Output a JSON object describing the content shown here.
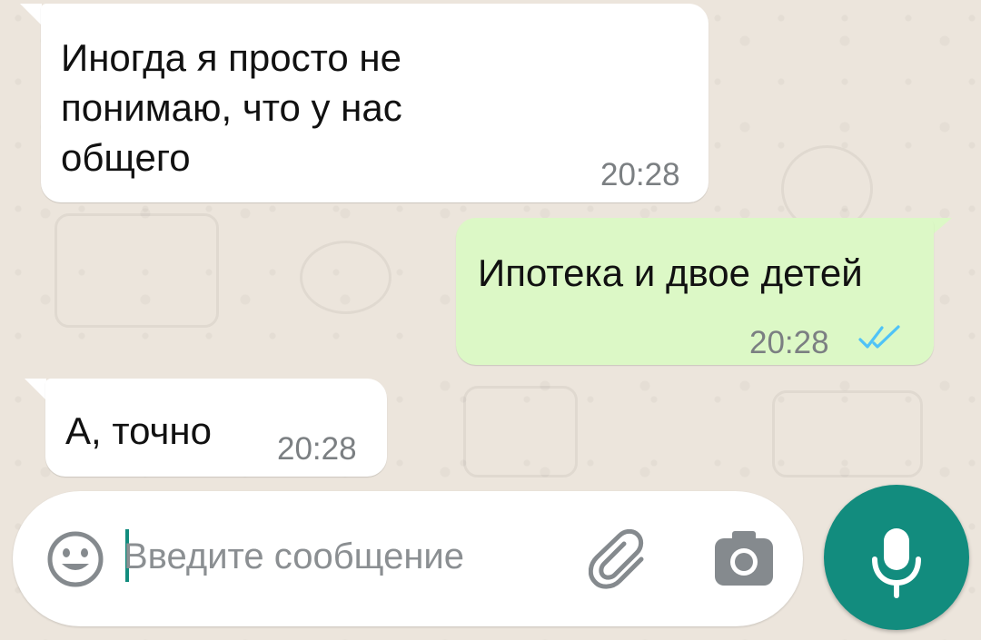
{
  "messages": [
    {
      "direction": "incoming",
      "text": "Иногда я просто не\nпонимаю, что у нас\nобщего",
      "time": "20:28"
    },
    {
      "direction": "outgoing",
      "text": "Ипотека и двое детей",
      "time": "20:28",
      "status": "read"
    },
    {
      "direction": "incoming",
      "text": "А, точно",
      "time": "20:28"
    }
  ],
  "composer": {
    "placeholder": "Введите сообщение",
    "value": "",
    "emoji_icon": "emoji-icon",
    "attach_icon": "paperclip-icon",
    "camera_icon": "camera-icon",
    "mic_icon": "microphone-icon"
  },
  "colors": {
    "background": "#ece5dc",
    "incoming_bubble": "#ffffff",
    "outgoing_bubble": "#dcf8c6",
    "read_ticks": "#4fc3f7",
    "accent": "#128c7e",
    "timestamp": "#7b7f82"
  }
}
